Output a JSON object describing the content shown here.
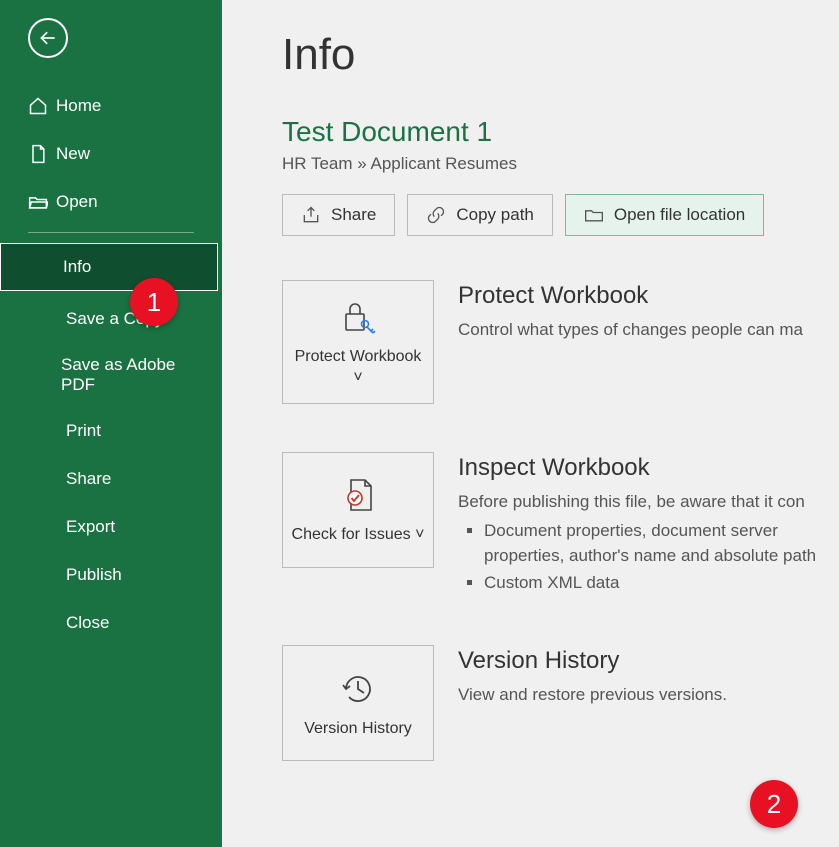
{
  "sidebar": {
    "items": [
      {
        "label": "Home",
        "icon": "home",
        "selected": false
      },
      {
        "label": "New",
        "icon": "new-doc",
        "selected": false
      },
      {
        "label": "Open",
        "icon": "folder-open",
        "selected": false
      },
      {
        "label": "Info",
        "selected": true
      },
      {
        "label": "Save a Copy",
        "selected": false
      },
      {
        "label": "Save as Adobe PDF",
        "selected": false
      },
      {
        "label": "Print",
        "selected": false
      },
      {
        "label": "Share",
        "selected": false
      },
      {
        "label": "Export",
        "selected": false
      },
      {
        "label": "Publish",
        "selected": false
      },
      {
        "label": "Close",
        "selected": false
      }
    ]
  },
  "main": {
    "page_title": "Info",
    "doc_title": "Test Document 1",
    "breadcrumb": "HR Team » Applicant Resumes",
    "actions": {
      "share": "Share",
      "copy_path": "Copy path",
      "open_location": "Open file location"
    },
    "sections": {
      "protect": {
        "button_label": "Protect Workbook ˅",
        "heading": "Protect Workbook",
        "desc": "Control what types of changes people can ma"
      },
      "inspect": {
        "button_label": "Check for Issues ˅",
        "heading": "Inspect Workbook",
        "desc": "Before publishing this file, be aware that it con",
        "items": [
          "Document properties, document server properties, author's name and absolute path",
          "Custom XML data"
        ]
      },
      "version": {
        "button_label": "Version History",
        "heading": "Version History",
        "desc": "View and restore previous versions."
      }
    }
  },
  "callouts": {
    "c1": "1",
    "c2": "2"
  }
}
